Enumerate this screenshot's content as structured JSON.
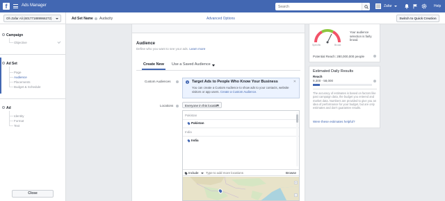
{
  "topbar": {
    "logo": "f",
    "app_title": "Ads Manager",
    "search_placeholder": "Search",
    "user_name": "Zafar",
    "help_label": "Help"
  },
  "adbar": {
    "account": "Oh Zafar Ali (601771889966272)",
    "adset_name_label": "Ad Set Name",
    "adset_name_value": "Audacity",
    "advanced_options": "Advanced Options",
    "quick_creation": "Switch to Quick Creation"
  },
  "nav": {
    "campaign": {
      "title": "Campaign",
      "items": [
        "Objective"
      ]
    },
    "adset": {
      "title": "Ad Set",
      "items": [
        "Page",
        "Audience",
        "Placements",
        "Budget & Schedule"
      ],
      "active": "Audience"
    },
    "ad": {
      "title": "Ad",
      "items": [
        "Identity",
        "Format",
        "Text"
      ]
    },
    "close": "Close"
  },
  "audience": {
    "title": "Audience",
    "desc": "Define who you want to see your ads.",
    "learn_more": "Learn more",
    "tabs": [
      "Create New",
      "Use a Saved Audience"
    ],
    "custom_audiences_label": "Custom Audiences",
    "tip_title": "Target Ads to People Who Know Your Business",
    "tip_text": "You can create a Custom Audience to show ads to your contacts, website visitors or app users.",
    "tip_link": "Create a Custom Audience.",
    "tip_close": "✕",
    "locations_label": "Locations",
    "location_filter": "Everyone in this location",
    "location_groups": [
      {
        "group": "Pakistan",
        "item": "Pakistan"
      },
      {
        "group": "India",
        "item": "India"
      }
    ],
    "include": "Include",
    "location_search_placeholder": "Type to add more locations",
    "browse": "Browse"
  },
  "definition": {
    "gauge_specific": "Specific",
    "gauge_broad": "Broad",
    "text": "Your audience selection is fairly broad.",
    "potential_reach": "Potential Reach: 280,000,000 people"
  },
  "estimates": {
    "title": "Estimated Daily Results",
    "reach_label": "Reach",
    "reach_range": "9,300 - 58,000",
    "reach_fill_fraction": 0.12,
    "note": "The accuracy of estimates is based on factors like past campaign data, the budget you entered and market data. Numbers are provided to give you an idea of performance for your budget, but are only estimates and don't guarantee results.",
    "link": "Were these estimates helpful?"
  },
  "colors": {
    "brand": "#4267b2",
    "background": "#e9ebee",
    "link": "#4267b2",
    "map_water": "#aad3df",
    "map_land": "#e8e3c9"
  }
}
